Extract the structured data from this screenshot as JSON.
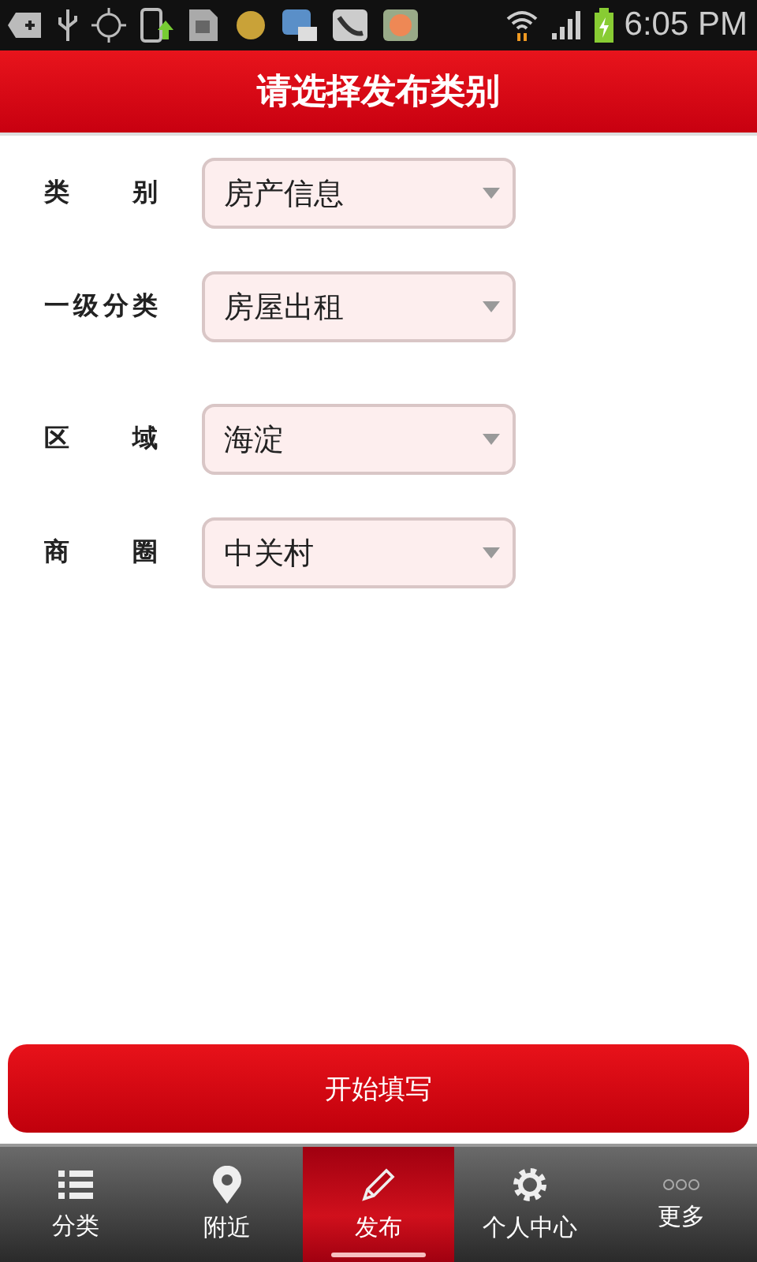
{
  "status_bar": {
    "time": "6:05 PM"
  },
  "header": {
    "title": "请选择发布类别"
  },
  "form": {
    "groups": [
      [
        {
          "label": "类 别",
          "value": "房产信息"
        },
        {
          "label": "一级分类",
          "value": "房屋出租"
        }
      ],
      [
        {
          "label": "区 域",
          "value": "海淀"
        },
        {
          "label": "商 圈",
          "value": "中关村"
        }
      ]
    ]
  },
  "submit_button": "开始填写",
  "tab_bar": [
    {
      "label": "分类",
      "kind": "list",
      "selected": false
    },
    {
      "label": "附近",
      "kind": "pin",
      "selected": false
    },
    {
      "label": "发布",
      "kind": "pencil",
      "selected": true
    },
    {
      "label": "个人中心",
      "kind": "gear",
      "selected": false
    },
    {
      "label": "更多",
      "kind": "dots",
      "selected": false
    }
  ]
}
